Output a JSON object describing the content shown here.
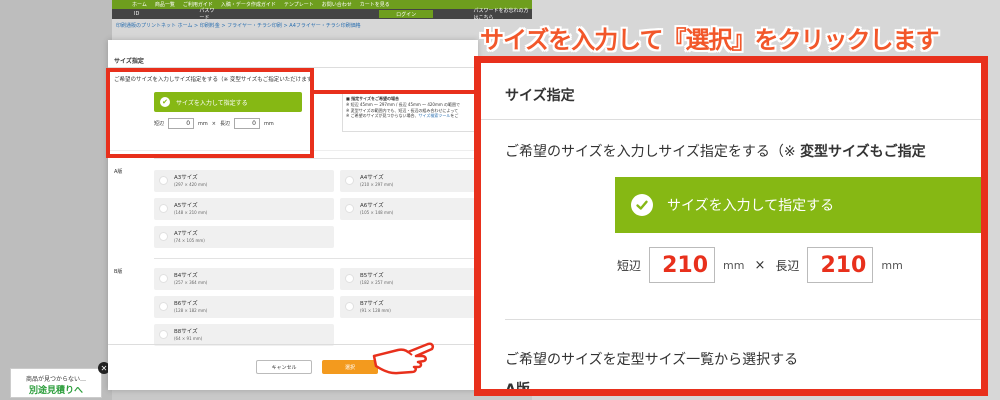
{
  "headline": "サイズを入力して『選択』をクリックします",
  "site": {
    "nav_items": [
      "ホーム",
      "商品一覧",
      "ご利用ガイド",
      "入稿・データ作成ガイド",
      "テンプレート",
      "お問い合わせ",
      "カートを見る"
    ],
    "id_label": "ID",
    "password_label": "パスワード",
    "login_label": "ログイン",
    "forgot_label": "パスワードをお忘れの方はこちら",
    "breadcrumb": "印刷通販のプリントネット ホーム > 印刷料金 > フライヤー・チラシ印刷 > A4フライヤー・チラシ印刷価格",
    "ad_line1": "商品が見つからない…",
    "ad_line2": "別途見積りへ",
    "ad_close": "✕"
  },
  "modal": {
    "title": "サイズ指定",
    "desc": "ご希望のサイズを入力しサイズ指定をする（※ 変型サイズもご指定いただけます）",
    "green_label": "サイズを入力して指定する",
    "short_label": "短辺",
    "short_value": "0",
    "long_label": "長辺",
    "long_value": "0",
    "unit": "mm",
    "times": "×",
    "note_title": "■ 指定サイズをご希望の場合",
    "note_line1": "※ 短辺 45mm ～ 297mm / 長辺 45mm ～ 420mm の範囲で",
    "note_line2": "※ 変型サイズの範囲内でも、短辺・長辺の組み合わせによって",
    "note_line3": "※ ご希望のサイズが見つからない場合、",
    "note_link": "サイズ検索ツール",
    "note_line3b": "をご",
    "section_a": "A版",
    "section_b": "B版",
    "a_sizes": [
      {
        "name": "A3サイズ",
        "dim": "(297 × 420 mm)"
      },
      {
        "name": "A4サイズ",
        "dim": "(210 × 297 mm)"
      },
      {
        "name": "A5サイズ",
        "dim": "(148 × 210 mm)"
      },
      {
        "name": "A6サイズ",
        "dim": "(105 × 148 mm)"
      },
      {
        "name": "A7サイズ",
        "dim": "(74 × 105 mm)"
      }
    ],
    "b_sizes": [
      {
        "name": "B4サイズ",
        "dim": "(257 × 364 mm)"
      },
      {
        "name": "B5サイズ",
        "dim": "(182 × 257 mm)"
      },
      {
        "name": "B6サイズ",
        "dim": "(128 × 182 mm)"
      },
      {
        "name": "B7サイズ",
        "dim": "(91 × 128 mm)"
      },
      {
        "name": "B8サイズ",
        "dim": "(64 × 91 mm)"
      }
    ],
    "cancel_label": "キャンセル",
    "select_label": "選択"
  },
  "zoom": {
    "title": "サイズ指定",
    "desc_plain": "ご希望のサイズを入力しサイズ指定をする（※ ",
    "desc_bold": "変型サイズもご指定",
    "green_label": "サイズを入力して指定する",
    "short_label": "短辺",
    "short_value": "210",
    "long_label": "長辺",
    "long_value": "210",
    "unit": "mm",
    "times": "×",
    "desc2": "ご希望のサイズを定型サイズ一覧から選択する",
    "section": "A版"
  },
  "colors": {
    "highlight": "#e8301c",
    "green": "#86b814",
    "orange": "#f39a1e",
    "headline": "#f2572a"
  }
}
